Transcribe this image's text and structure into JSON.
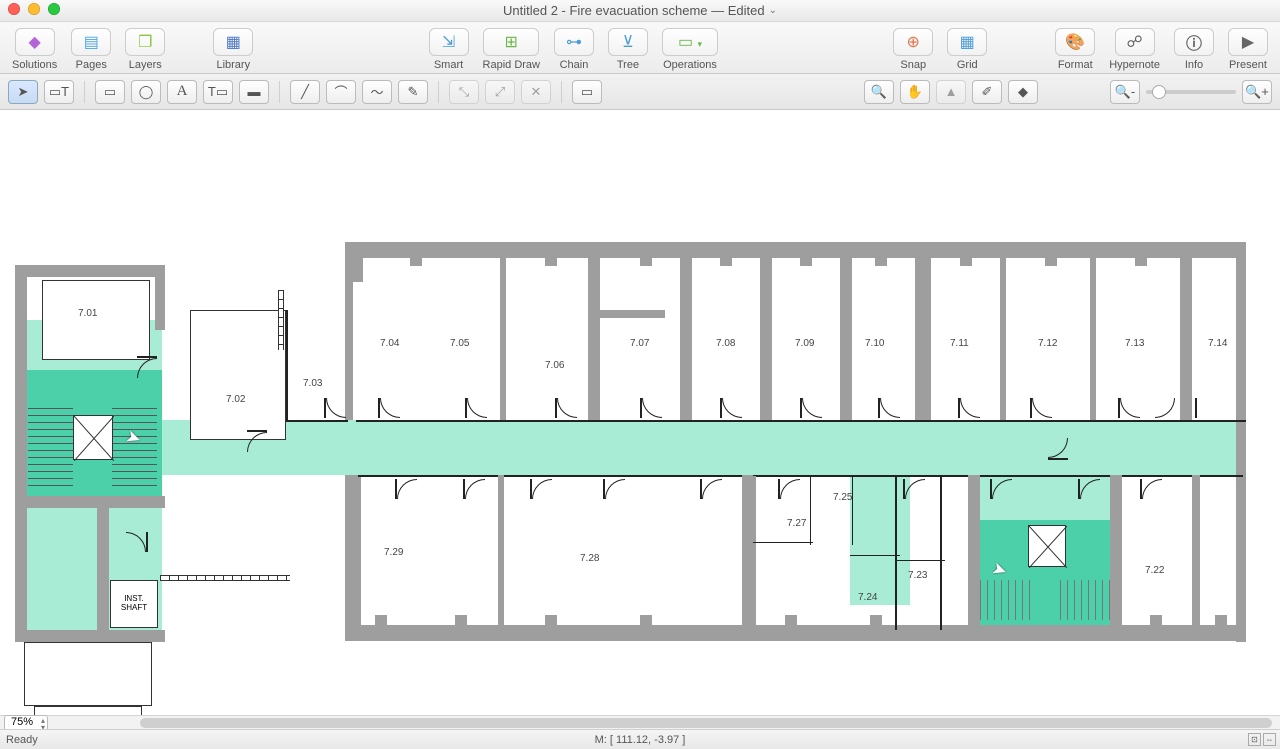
{
  "title": {
    "text": "Untitled 2 - Fire evacuation scheme — Edited"
  },
  "toolbar": {
    "solutions": "Solutions",
    "pages": "Pages",
    "layers": "Layers",
    "library": "Library",
    "smart": "Smart",
    "rapid": "Rapid Draw",
    "chain": "Chain",
    "tree": "Tree",
    "ops": "Operations",
    "snap": "Snap",
    "grid": "Grid",
    "format": "Format",
    "hyper": "Hypernote",
    "info": "Info",
    "present": "Present"
  },
  "zoom_percent": "75%",
  "status": {
    "ready": "Ready",
    "coord": "M: [ 111.12, -3.97 ]"
  },
  "rooms": {
    "r701": "7.01",
    "r702": "7.02",
    "r703": "7.03",
    "r704": "7.04",
    "r705": "7.05",
    "r706": "7.06",
    "r707": "7.07",
    "r708": "7.08",
    "r709": "7.09",
    "r710": "7.10",
    "r711": "7.11",
    "r712": "7.12",
    "r713": "7.13",
    "r714": "7.14",
    "r722": "7.22",
    "r723": "7.23",
    "r724": "7.24",
    "r725": "7.25",
    "r727": "7.27",
    "r728": "7.28",
    "r729": "7.29",
    "inst": "INST.\nSHAFT"
  }
}
